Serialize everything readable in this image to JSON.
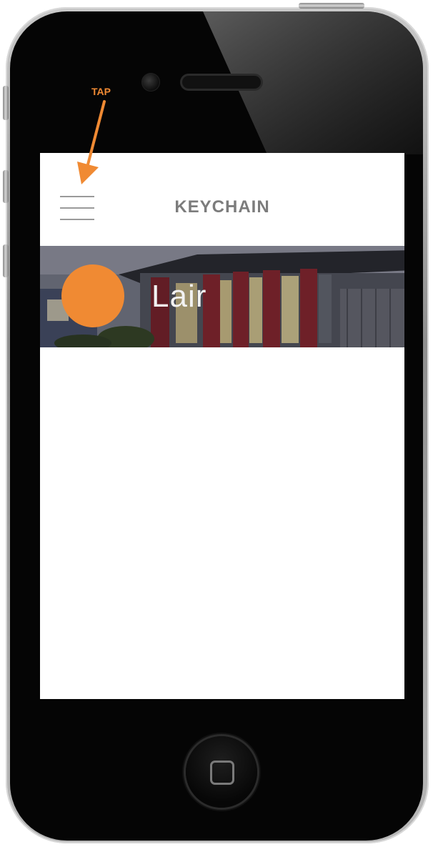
{
  "annotation": {
    "label": "TAP"
  },
  "app": {
    "title": "KEYCHAIN",
    "menu_icon": "hamburger-menu-icon"
  },
  "place": {
    "name": "Lair"
  },
  "colors": {
    "accent": "#f08a33",
    "title_text": "#7c7c7c",
    "menu_lines": "#9a9a9a",
    "phone_face": "#050505",
    "screen_bg": "#ffffff"
  }
}
